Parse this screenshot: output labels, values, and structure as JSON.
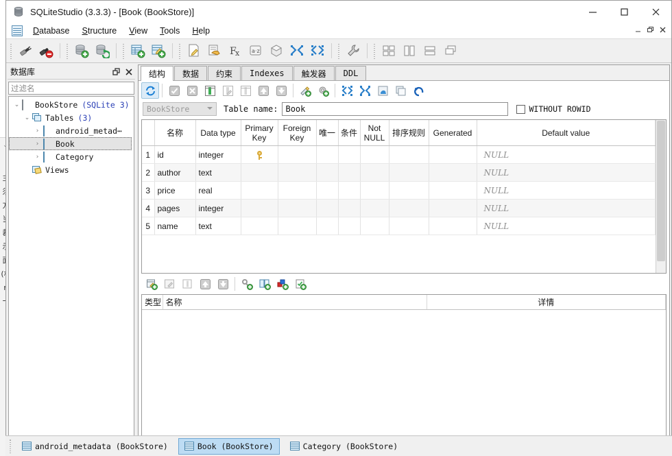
{
  "window": {
    "title": "SQLiteStudio (3.3.3) - [Book (BookStore)]",
    "app_icon": "database-cylinder-icon",
    "minimize": "—",
    "maximize": "☐",
    "close": "✕"
  },
  "mdi_controls": {
    "minimize": "–",
    "restore": "❐",
    "close": "✕"
  },
  "menubar": {
    "icon": "grid-table-icon",
    "items": [
      {
        "label": "Database",
        "accel": "D"
      },
      {
        "label": "Structure",
        "accel": "S"
      },
      {
        "label": "View",
        "accel": "V"
      },
      {
        "label": "Tools",
        "accel": "T"
      },
      {
        "label": "Help",
        "accel": "H"
      }
    ]
  },
  "toolbar": {
    "groups": [
      {
        "buttons": [
          {
            "name": "connect-database-icon",
            "title": "Connect to the database"
          },
          {
            "name": "disconnect-database-icon",
            "title": "Disconnect from the database"
          }
        ]
      },
      {
        "buttons": [
          {
            "name": "add-database-icon",
            "title": "Add a database"
          },
          {
            "name": "refresh-database-icon",
            "title": "Refresh database schema"
          }
        ]
      },
      {
        "buttons": [
          {
            "name": "create-table-icon",
            "title": "Create a table"
          },
          {
            "name": "edit-table-icon",
            "title": "Edit the table"
          }
        ]
      },
      {
        "buttons": [
          {
            "name": "open-sql-editor-icon",
            "title": "Open SQL editor"
          },
          {
            "name": "open-query-history-icon",
            "title": "Open query history"
          },
          {
            "name": "custom-sql-functions-icon",
            "title": "Custom SQL functions editor"
          },
          {
            "name": "collations-icon",
            "title": "Collations editor"
          },
          {
            "name": "extensions-icon",
            "title": "Extensions manager"
          },
          {
            "name": "import-icon",
            "title": "Import"
          },
          {
            "name": "export-icon",
            "title": "Export"
          }
        ]
      },
      {
        "buttons": [
          {
            "name": "settings-wrench-icon",
            "title": "Open configuration dialog"
          }
        ]
      },
      {
        "buttons": [
          {
            "name": "tile-windows-icon",
            "title": "Tile windows"
          },
          {
            "name": "tile-vertically-icon",
            "title": "Tile windows vertically"
          },
          {
            "name": "tile-horizontally-icon",
            "title": "Tile windows horizontally"
          },
          {
            "name": "cascade-windows-icon",
            "title": "Cascade windows"
          }
        ]
      }
    ]
  },
  "dock": {
    "title": "数据库",
    "float_button": "❐",
    "close_button": "✕",
    "filter_placeholder": "过滤名",
    "filter_value": "",
    "tree": [
      {
        "label": "BookStore",
        "sub": "(SQLite 3)",
        "icon": "database-icon",
        "twisty": "⌄",
        "indent": 0,
        "selected": false
      },
      {
        "label": "Tables",
        "sub": "(3)",
        "icon": "tables-icon",
        "twisty": "⌄",
        "indent": 1,
        "selected": false
      },
      {
        "label": "android_metad⋯",
        "sub": "",
        "icon": "table-icon",
        "twisty": "›",
        "indent": 2,
        "selected": false
      },
      {
        "label": "Book",
        "sub": "",
        "icon": "table-icon",
        "twisty": "›",
        "indent": 2,
        "selected": true
      },
      {
        "label": "Category",
        "sub": "",
        "icon": "table-icon",
        "twisty": "›",
        "indent": 2,
        "selected": false
      },
      {
        "label": "Views",
        "sub": "",
        "icon": "views-icon",
        "twisty": "",
        "indent": 1,
        "selected": false
      }
    ]
  },
  "editor": {
    "tabs": [
      {
        "label": "结构",
        "active": true,
        "cn": true
      },
      {
        "label": "数据",
        "active": false,
        "cn": true
      },
      {
        "label": "约束",
        "active": false,
        "cn": true
      },
      {
        "label": "Indexes",
        "active": false,
        "cn": false
      },
      {
        "label": "触发器",
        "active": false,
        "cn": true
      },
      {
        "label": "DDL",
        "active": false,
        "cn": false
      }
    ],
    "structure_toolbar": [
      {
        "name": "refresh-structure-icon",
        "title": "Refresh structure",
        "active": true
      },
      {
        "name": "commit-structure-icon",
        "title": "Commit structure changes",
        "active": false
      },
      {
        "name": "rollback-structure-icon",
        "title": "Rollback structure changes",
        "active": false
      },
      {
        "name": "add-column-icon",
        "title": "Add column",
        "active": false
      },
      {
        "name": "edit-column-icon",
        "title": "Edit column",
        "active": false
      },
      {
        "name": "delete-column-icon",
        "title": "Delete column",
        "active": false
      },
      {
        "name": "move-column-up-icon",
        "title": "Move column up",
        "active": false
      },
      {
        "name": "move-column-down-icon",
        "title": "Move column down",
        "active": false
      },
      {
        "name": "create-index-icon",
        "title": "Create index",
        "active": false
      },
      {
        "name": "create-trigger-icon",
        "title": "Create trigger",
        "active": false
      },
      {
        "name": "export-table-icon",
        "title": "Export table",
        "active": false
      },
      {
        "name": "import-table-icon",
        "title": "Import into table",
        "active": false
      },
      {
        "name": "populate-table-icon",
        "title": "Populate table",
        "active": false
      },
      {
        "name": "duplicate-table-icon",
        "title": "Duplicate table",
        "active": false
      },
      {
        "name": "reset-autoincrement-icon",
        "title": "Reset autoincrement value",
        "active": false
      }
    ],
    "database_select": {
      "value": "BookStore",
      "enabled": false
    },
    "table_name_label": "Table name:",
    "table_name_value": "Book",
    "without_rowid": {
      "label": "WITHOUT ROWID",
      "checked": false
    },
    "columns_grid": {
      "headers": [
        "名称",
        "Data type",
        "Primary Key",
        "Foreign Key",
        "唯一",
        "条件",
        "Not NULL",
        "排序规则",
        "Generated",
        "Default value"
      ],
      "rows": [
        {
          "num": "1",
          "name": "id",
          "data_type": "integer",
          "primary_key": true,
          "foreign_key": "",
          "unique": "",
          "check": "",
          "not_null": "",
          "collate": "",
          "generated": "",
          "default_value": "NULL"
        },
        {
          "num": "2",
          "name": "author",
          "data_type": "text",
          "primary_key": false,
          "foreign_key": "",
          "unique": "",
          "check": "",
          "not_null": "",
          "collate": "",
          "generated": "",
          "default_value": "NULL"
        },
        {
          "num": "3",
          "name": "price",
          "data_type": "real",
          "primary_key": false,
          "foreign_key": "",
          "unique": "",
          "check": "",
          "not_null": "",
          "collate": "",
          "generated": "",
          "default_value": "NULL"
        },
        {
          "num": "4",
          "name": "pages",
          "data_type": "integer",
          "primary_key": false,
          "foreign_key": "",
          "unique": "",
          "check": "",
          "not_null": "",
          "collate": "",
          "generated": "",
          "default_value": "NULL"
        },
        {
          "num": "5",
          "name": "name",
          "data_type": "text",
          "primary_key": false,
          "foreign_key": "",
          "unique": "",
          "check": "",
          "not_null": "",
          "collate": "",
          "generated": "",
          "default_value": "NULL"
        }
      ]
    },
    "constraints_toolbar": [
      {
        "name": "add-constraint-icon",
        "title": "Add table constraint"
      },
      {
        "name": "edit-constraint-icon",
        "title": "Edit table constraint"
      },
      {
        "name": "delete-constraint-icon",
        "title": "Delete table constraint"
      },
      {
        "name": "move-constraint-up-icon",
        "title": "Move constraint up"
      },
      {
        "name": "move-constraint-down-icon",
        "title": "Move constraint down"
      },
      {
        "name": "add-primary-key-icon",
        "title": "Add primary key"
      },
      {
        "name": "add-foreign-key-icon",
        "title": "Add foreign key"
      },
      {
        "name": "add-unique-constraint-icon",
        "title": "Add unique constraint"
      },
      {
        "name": "add-check-constraint-icon",
        "title": "Add check constraint"
      }
    ],
    "constraints_grid": {
      "headers": [
        "类型",
        "名称",
        "详情"
      ],
      "rows": []
    }
  },
  "taskbar": {
    "windows": [
      {
        "label": "android_metadata (BookStore)",
        "active": false
      },
      {
        "label": "Book (BookStore)",
        "active": true
      },
      {
        "label": "Category (BookStore)",
        "active": false
      }
    ]
  },
  "colors": {
    "accent_blue": "#2a3fb5",
    "selection_blue": "#bddcf4",
    "table_icon_blue": "#4d87ad",
    "null_gray": "#8e8e8e"
  }
}
